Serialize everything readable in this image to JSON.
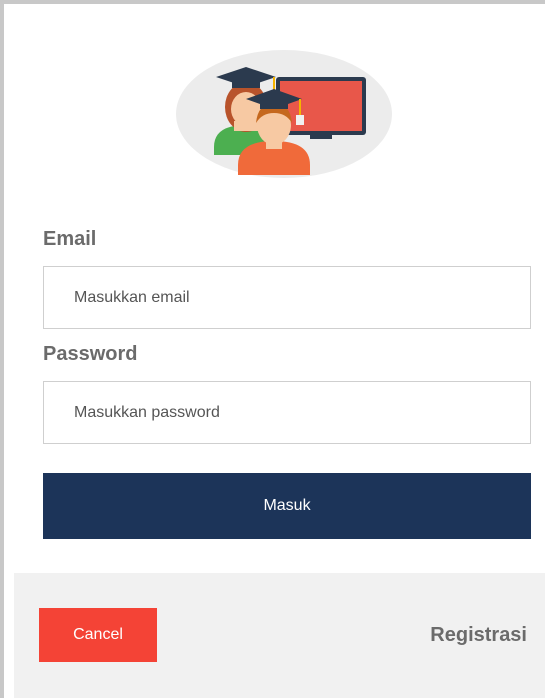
{
  "login": {
    "email_label": "Email",
    "email_placeholder": "Masukkan email",
    "password_label": "Password",
    "password_placeholder": "Masukkan password",
    "submit_label": "Masuk"
  },
  "footer": {
    "cancel_label": "Cancel",
    "register_label": "Registrasi"
  },
  "avatar": {
    "icon": "graduates-computer-icon"
  },
  "colors": {
    "primary": "#1c3459",
    "cancel": "#f44336",
    "label": "#6b6b6b",
    "footer_bg": "#f1f1f1"
  }
}
